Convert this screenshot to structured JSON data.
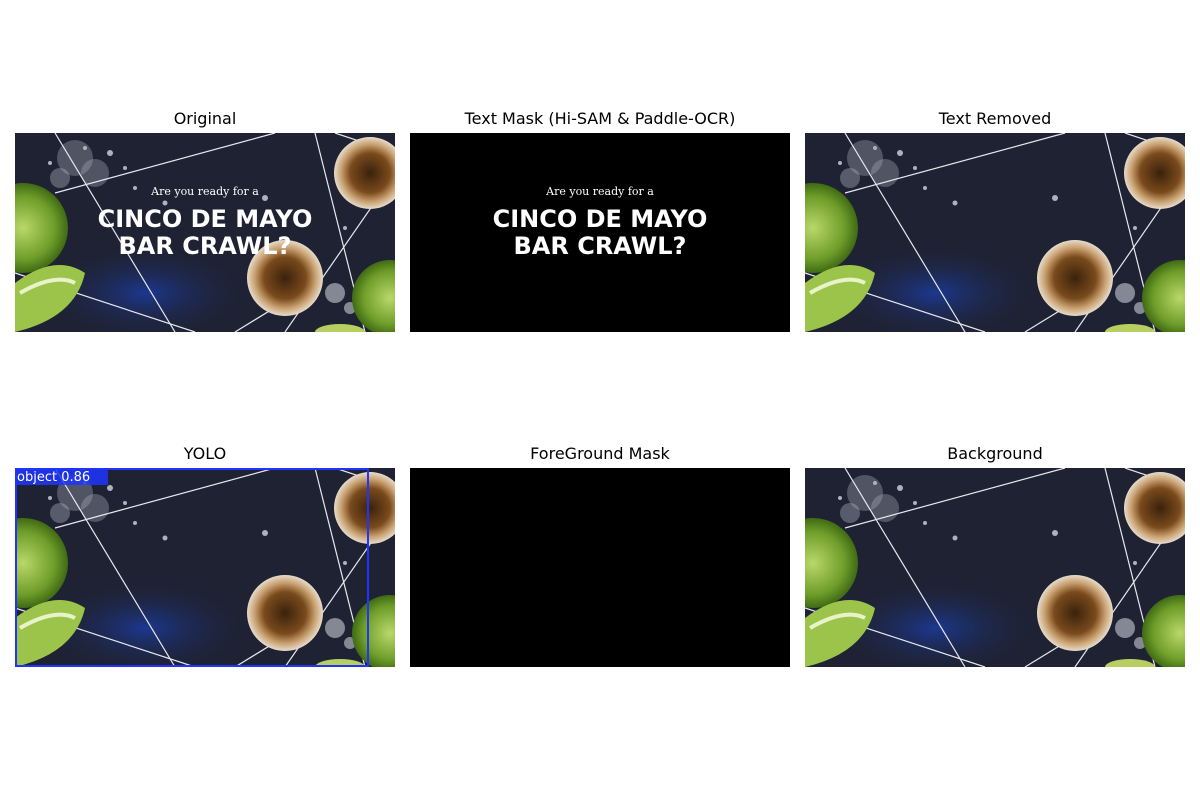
{
  "panels": {
    "original": {
      "title": "Original"
    },
    "text_mask": {
      "title": "Text Mask (Hi-SAM & Paddle-OCR)"
    },
    "text_removed": {
      "title": "Text Removed"
    },
    "yolo": {
      "title": "YOLO",
      "detection_label": "object  0.86"
    },
    "foreground_mask": {
      "title": "ForeGround Mask"
    },
    "background": {
      "title": "Background"
    }
  },
  "poster": {
    "line1": "Are you ready for a",
    "line2": "CINCO DE MAYO",
    "line3": "BAR CRAWL?"
  },
  "colors": {
    "scene_bg": "#1e2233",
    "lime": "#6f9d2a",
    "glass": "#7a4a1c",
    "salt": "#c9ccd6",
    "yolo_box": "#1f35ff"
  }
}
